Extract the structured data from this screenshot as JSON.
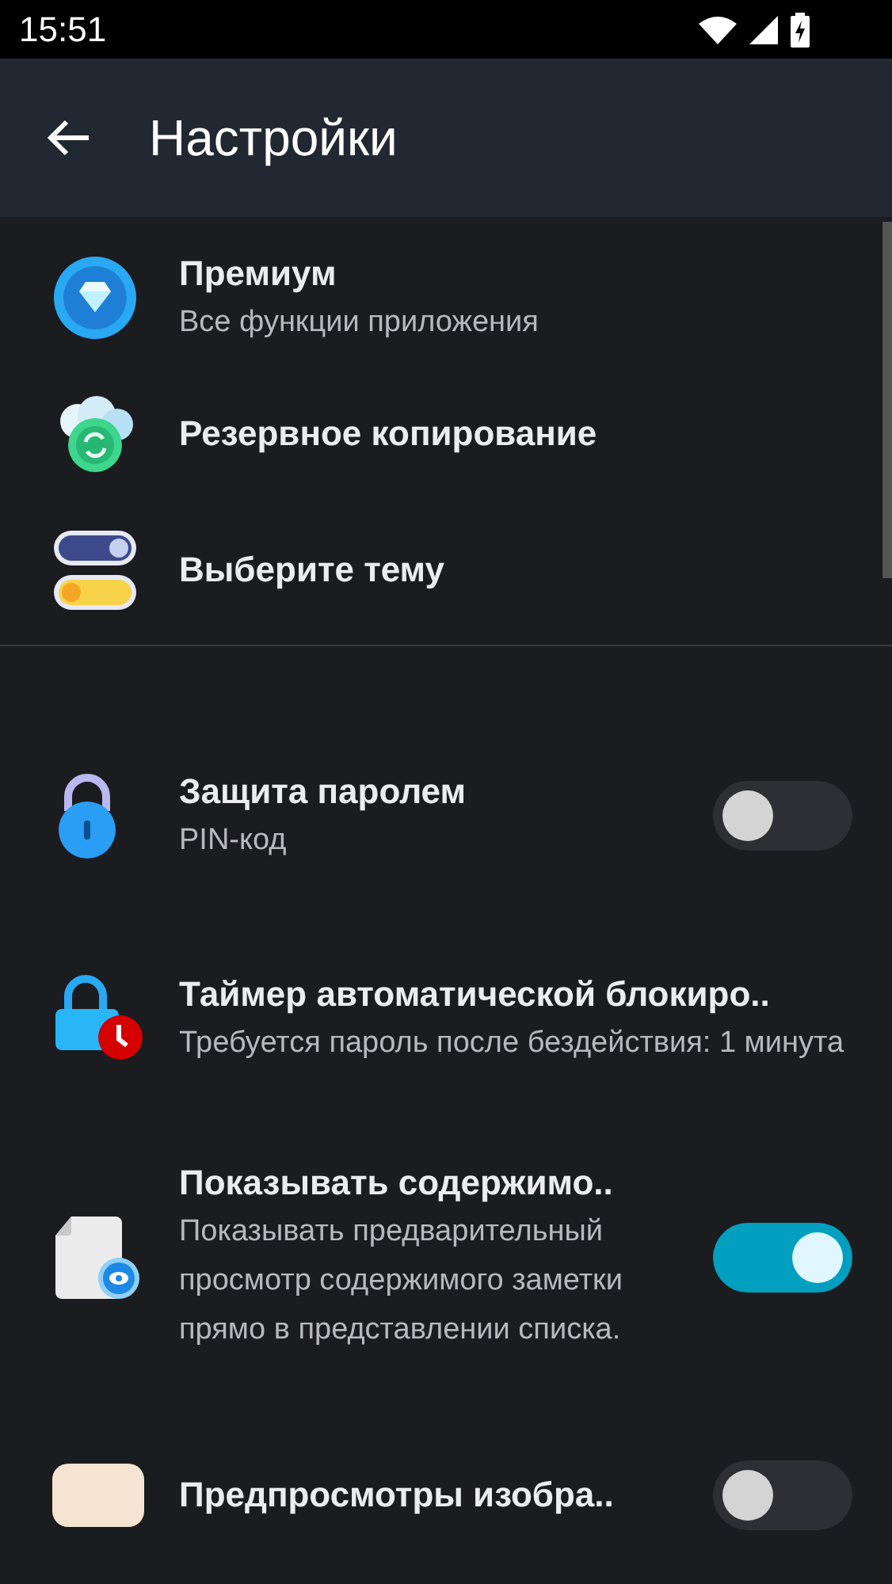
{
  "status_bar": {
    "time": "15:51"
  },
  "app_bar": {
    "title": "Настройки"
  },
  "groups": [
    {
      "items": [
        {
          "title": "Премиум",
          "subtitle": "Все функции приложения"
        },
        {
          "title": "Резервное копирование"
        },
        {
          "title": "Выберите тему"
        }
      ]
    },
    {
      "items": [
        {
          "title": "Защита паролем",
          "subtitle": "PIN-код",
          "kind": "switch",
          "on": false
        },
        {
          "title": "Таймер автоматической блокиро..",
          "subtitle": "Требуется пароль после бездействия: 1 минута"
        },
        {
          "title": "Показывать содержимо..",
          "subtitle": "Показывать предварительный просмотр содержимого заметки прямо в представлении списка.",
          "kind": "switch",
          "on": true
        },
        {
          "title": "Предпросмотры изобра..",
          "kind": "switch",
          "on": false
        }
      ]
    }
  ]
}
